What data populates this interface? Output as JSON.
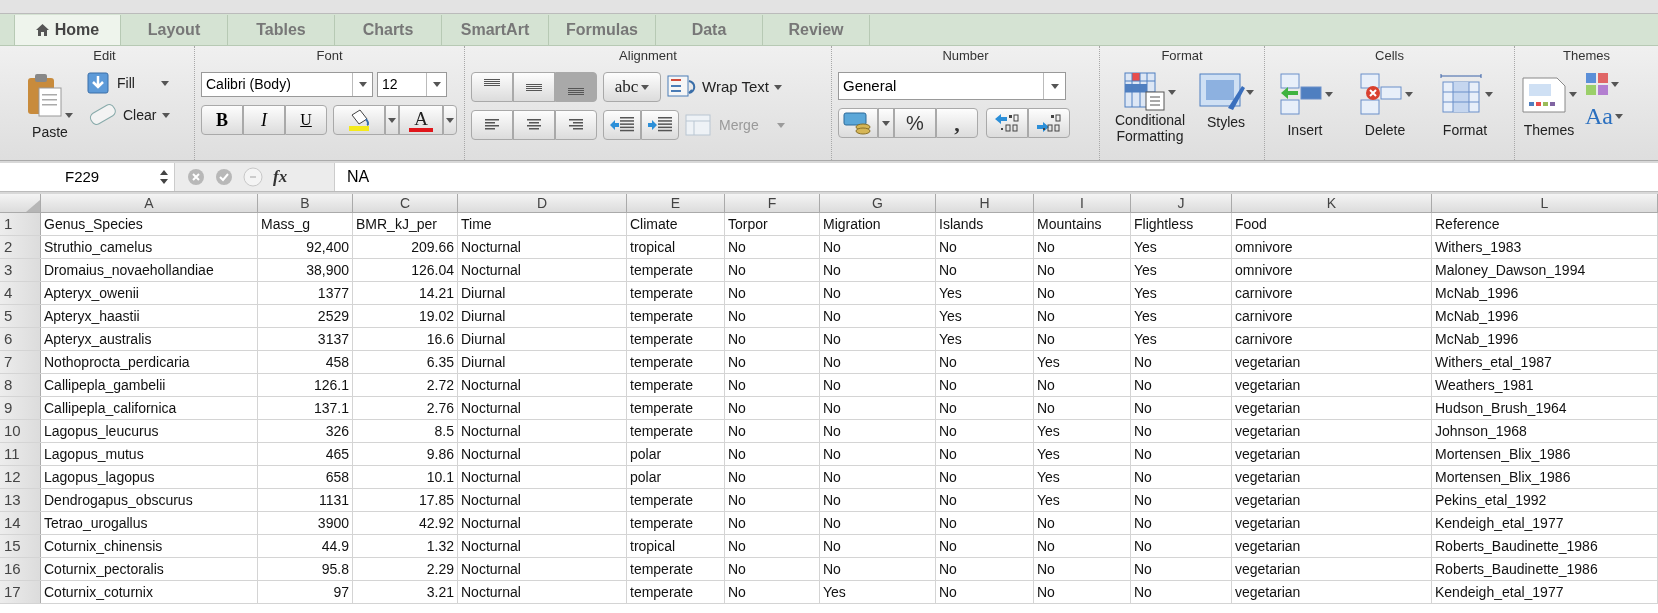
{
  "tabs": [
    {
      "label": "Home",
      "selected": true
    },
    {
      "label": "Layout",
      "selected": false
    },
    {
      "label": "Tables",
      "selected": false
    },
    {
      "label": "Charts",
      "selected": false
    },
    {
      "label": "SmartArt",
      "selected": false
    },
    {
      "label": "Formulas",
      "selected": false
    },
    {
      "label": "Data",
      "selected": false
    },
    {
      "label": "Review",
      "selected": false
    }
  ],
  "ribbon": {
    "edit": {
      "title": "Edit",
      "paste": "Paste",
      "fill": "Fill",
      "clear": "Clear"
    },
    "font": {
      "title": "Font",
      "font_name": "Calibri (Body)",
      "font_size": "12",
      "bold": "B",
      "italic": "I",
      "underline": "U",
      "font_color": "A"
    },
    "alignment": {
      "title": "Alignment",
      "vertical": [
        {
          "selected": false
        },
        {
          "selected": false
        },
        {
          "selected": true
        }
      ],
      "orientation": "abc",
      "wrap_text": "Wrap Text",
      "merge": {
        "label": "Merge",
        "disabled": true
      }
    },
    "number": {
      "title": "Number",
      "format": "General",
      "percent": "%",
      "comma": ","
    },
    "format": {
      "title": "Format",
      "conditional": "Conditional Formatting",
      "styles": "Styles"
    },
    "cells": {
      "title": "Cells",
      "insert": "Insert",
      "delete": "Delete",
      "format": "Format"
    },
    "themes": {
      "title": "Themes",
      "themes": "Themes",
      "fonts": "Aa"
    }
  },
  "formula_bar": {
    "name_box": "F229",
    "fx": "fx",
    "value": "NA"
  },
  "table": {
    "columns": [
      {
        "letter": "A",
        "kind": "text"
      },
      {
        "letter": "B",
        "kind": "number"
      },
      {
        "letter": "C",
        "kind": "number"
      },
      {
        "letter": "D",
        "kind": "text"
      },
      {
        "letter": "E",
        "kind": "text"
      },
      {
        "letter": "F",
        "kind": "text"
      },
      {
        "letter": "G",
        "kind": "text"
      },
      {
        "letter": "H",
        "kind": "text"
      },
      {
        "letter": "I",
        "kind": "text"
      },
      {
        "letter": "J",
        "kind": "text"
      },
      {
        "letter": "K",
        "kind": "text"
      },
      {
        "letter": "L",
        "kind": "text"
      }
    ],
    "rows": [
      {
        "number": "1",
        "kind": "header",
        "cells": [
          "Genus_Species",
          "Mass_g",
          "BMR_kJ_per",
          "Time",
          "Climate",
          "Torpor",
          "Migration",
          "Islands",
          "Mountains",
          "Flightless",
          "Food",
          "Reference"
        ]
      },
      {
        "number": "2",
        "kind": "data",
        "cells": [
          "Struthio_camelus",
          "92,400",
          "209.66",
          "Nocturnal",
          "tropical",
          "No",
          "No",
          "No",
          "No",
          "Yes",
          "omnivore",
          "Withers_1983"
        ]
      },
      {
        "number": "3",
        "kind": "data",
        "cells": [
          "Dromaius_novaehollandiae",
          "38,900",
          "126.04",
          "Nocturnal",
          "temperate",
          "No",
          "No",
          "No",
          "No",
          "Yes",
          "omnivore",
          "Maloney_Dawson_1994"
        ]
      },
      {
        "number": "4",
        "kind": "data",
        "cells": [
          "Apteryx_owenii",
          "1377",
          "14.21",
          "Diurnal",
          "temperate",
          "No",
          "No",
          "Yes",
          "No",
          "Yes",
          "carnivore",
          "McNab_1996"
        ]
      },
      {
        "number": "5",
        "kind": "data",
        "cells": [
          "Apteryx_haastii",
          "2529",
          "19.02",
          "Diurnal",
          "temperate",
          "No",
          "No",
          "Yes",
          "No",
          "Yes",
          "carnivore",
          "McNab_1996"
        ]
      },
      {
        "number": "6",
        "kind": "data",
        "cells": [
          "Apteryx_australis",
          "3137",
          "16.6",
          "Diurnal",
          "temperate",
          "No",
          "No",
          "Yes",
          "No",
          "Yes",
          "carnivore",
          "McNab_1996"
        ]
      },
      {
        "number": "7",
        "kind": "data",
        "cells": [
          "Nothoprocta_perdicaria",
          "458",
          "6.35",
          "Diurnal",
          "temperate",
          "No",
          "No",
          "No",
          "Yes",
          "No",
          "vegetarian",
          "Withers_etal_1987"
        ]
      },
      {
        "number": "8",
        "kind": "data",
        "cells": [
          "Callipepla_gambelii",
          "126.1",
          "2.72",
          "Nocturnal",
          "temperate",
          "No",
          "No",
          "No",
          "No",
          "No",
          "vegetarian",
          "Weathers_1981"
        ]
      },
      {
        "number": "9",
        "kind": "data",
        "cells": [
          "Callipepla_californica",
          "137.1",
          "2.76",
          "Nocturnal",
          "temperate",
          "No",
          "No",
          "No",
          "No",
          "No",
          "vegetarian",
          "Hudson_Brush_1964"
        ]
      },
      {
        "number": "10",
        "kind": "data",
        "cells": [
          "Lagopus_leucurus",
          "326",
          "8.5",
          "Nocturnal",
          "temperate",
          "No",
          "No",
          "No",
          "Yes",
          "No",
          "vegetarian",
          "Johnson_1968"
        ]
      },
      {
        "number": "11",
        "kind": "data",
        "cells": [
          "Lagopus_mutus",
          "465",
          "9.86",
          "Nocturnal",
          "polar",
          "No",
          "No",
          "No",
          "Yes",
          "No",
          "vegetarian",
          "Mortensen_Blix_1986"
        ]
      },
      {
        "number": "12",
        "kind": "data",
        "cells": [
          "Lagopus_lagopus",
          "658",
          "10.1",
          "Nocturnal",
          "polar",
          "No",
          "No",
          "No",
          "Yes",
          "No",
          "vegetarian",
          "Mortensen_Blix_1986"
        ]
      },
      {
        "number": "13",
        "kind": "data",
        "cells": [
          "Dendrogapus_obscurus",
          "1131",
          "17.85",
          "Nocturnal",
          "temperate",
          "No",
          "No",
          "No",
          "Yes",
          "No",
          "vegetarian",
          "Pekins_etal_1992"
        ]
      },
      {
        "number": "14",
        "kind": "data",
        "cells": [
          "Tetrao_urogallus",
          "3900",
          "42.92",
          "Nocturnal",
          "temperate",
          "No",
          "No",
          "No",
          "No",
          "No",
          "vegetarian",
          "Kendeigh_etal_1977"
        ]
      },
      {
        "number": "15",
        "kind": "data",
        "cells": [
          "Coturnix_chinensis",
          "44.9",
          "1.32",
          "Nocturnal",
          "tropical",
          "No",
          "No",
          "No",
          "No",
          "No",
          "vegetarian",
          "Roberts_Baudinette_1986"
        ]
      },
      {
        "number": "16",
        "kind": "data",
        "cells": [
          "Coturnix_pectoralis",
          "95.8",
          "2.29",
          "Nocturnal",
          "temperate",
          "No",
          "No",
          "No",
          "No",
          "No",
          "vegetarian",
          "Roberts_Baudinette_1986"
        ]
      },
      {
        "number": "17",
        "kind": "data",
        "cells": [
          "Coturnix_coturnix",
          "97",
          "3.21",
          "Nocturnal",
          "temperate",
          "No",
          "Yes",
          "No",
          "No",
          "No",
          "vegetarian",
          "Kendeigh_etal_1977"
        ]
      }
    ]
  }
}
